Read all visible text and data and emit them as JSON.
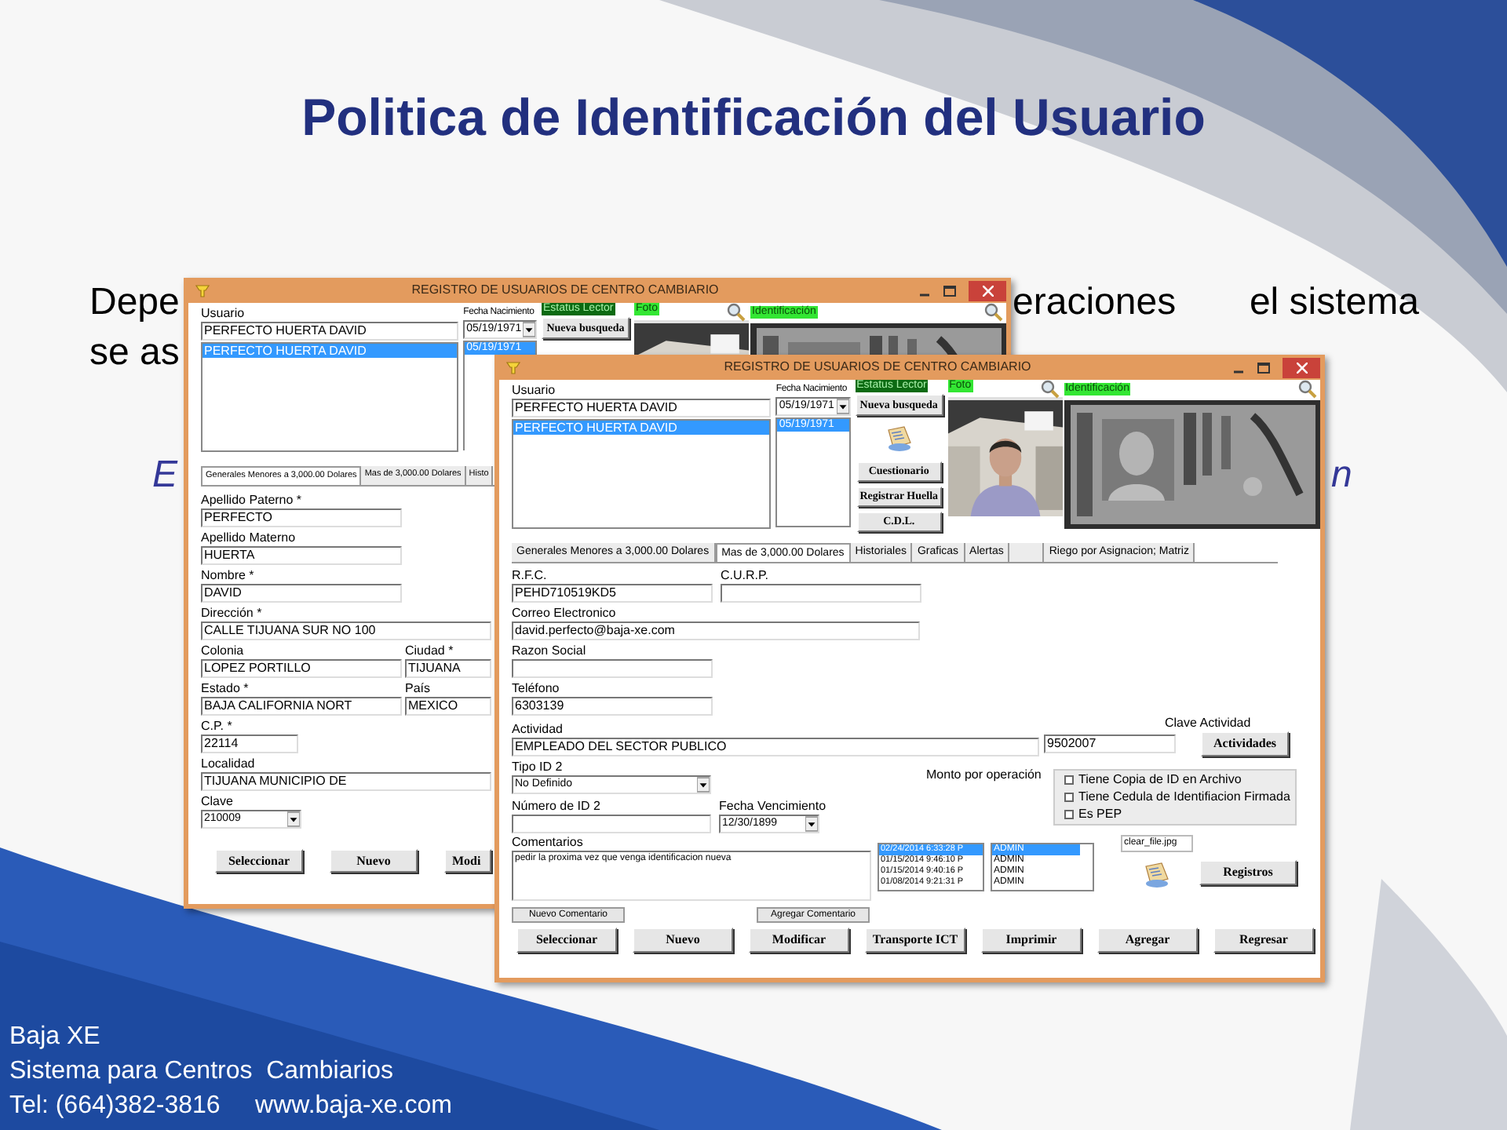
{
  "slide": {
    "title": "Politica de Identificación del Usuario",
    "line_1_start": "Depe",
    "line_1_mid": "eraciones",
    "line_1_end": "el sistema",
    "line_2_start": "se as",
    "line_3_start": "E",
    "line_3_end": "n",
    "footer": [
      "Baja XE",
      "Sistema para Centros  Cambiarios",
      "Tel: (664)382-3816     www.baja-xe.com"
    ]
  },
  "back_window": {
    "title": "REGISTRO DE USUARIOS DE CENTRO CAMBIARIO",
    "user_label": "Usuario",
    "user_value": "PERFECTO HUERTA DAVID",
    "user_list": [
      {
        "text": "PERFECTO HUERTA DAVID",
        "selected": true
      }
    ],
    "date_label": "Fecha Nacimiento",
    "date_value": "05/19/1971",
    "date_list": [
      {
        "text": "05/19/1971",
        "selected": true
      }
    ],
    "status_label": "Estatus Lector",
    "search_button": "Nueva busqueda",
    "photo_label": "Foto",
    "id_label": "Identificación",
    "tabs": [
      {
        "label": "Generales Menores a 3,000.00 Dolares",
        "selected": true
      },
      {
        "label": "Mas de 3,000.00 Dolares",
        "selected": false
      },
      {
        "label": "Histo",
        "selected": false
      }
    ],
    "field_rows": [
      [
        {
          "label": "Apellido Paterno *",
          "value": "PERFECTO",
          "kind": "medium"
        }
      ],
      [
        {
          "label": "Apellido Materno",
          "value": "HUERTA",
          "kind": "medium"
        }
      ],
      [
        {
          "label": "Nombre *",
          "value": "DAVID",
          "kind": "medium"
        }
      ],
      [
        {
          "label": "Dirección *",
          "value": "CALLE TIJUANA SUR NO 100",
          "kind": "wide"
        }
      ],
      [
        {
          "label": "Colonia",
          "value": "LOPEZ PORTILLO",
          "kind": "medium"
        },
        {
          "label": "Ciudad *",
          "value": "TIJUANA",
          "kind": "partial"
        }
      ],
      [
        {
          "label": "Estado *",
          "value": "BAJA CALIFORNIA NORT",
          "kind": "medium"
        },
        {
          "label": "País",
          "value": "MEXICO",
          "kind": "partial"
        }
      ],
      [
        {
          "label": "C.P. *",
          "value": "22114",
          "kind": "short"
        }
      ],
      [
        {
          "label": "Localidad",
          "value": "TIJUANA MUNICIPIO DE",
          "kind": "wide"
        }
      ],
      [
        {
          "label": "Clave",
          "value": "210009",
          "kind": "select"
        }
      ]
    ],
    "buttons": [
      "Seleccionar",
      "Nuevo",
      "Modi"
    ]
  },
  "front_window": {
    "title": "REGISTRO DE USUARIOS DE CENTRO CAMBIARIO",
    "user_label": "Usuario",
    "user_value": "PERFECTO HUERTA DAVID",
    "user_list": [
      {
        "text": "PERFECTO HUERTA DAVID",
        "selected": true
      }
    ],
    "date_label": "Fecha Nacimiento",
    "date_value": "05/19/1971",
    "date_list": [
      {
        "text": "05/19/1971",
        "selected": true
      }
    ],
    "status_label": "Estatus Lector",
    "search_button": "Nueva busqueda",
    "side_buttons": [
      "Cuestionario",
      "Registrar Huella",
      "C.D.L."
    ],
    "photo_label": "Foto",
    "id_label": "Identificación",
    "tabs": [
      {
        "label": "Generales Menores a 3,000.00 Dolares",
        "selected": false
      },
      {
        "label": "Mas de 3,000.00 Dolares",
        "selected": true
      },
      {
        "label": "Historiales",
        "selected": false
      },
      {
        "label": "Graficas",
        "selected": false
      },
      {
        "label": "Alertas",
        "selected": false
      },
      {
        "label": "Riego por Asignacion; Matriz",
        "selected": false
      }
    ],
    "rfc": {
      "label": "R.F.C.",
      "value": "PEHD710519KD5"
    },
    "curp": {
      "label": "C.U.R.P."
    },
    "email": {
      "label": "Correo Electronico",
      "value": "david.perfecto@baja-xe.com"
    },
    "razon": {
      "label": "Razon Social"
    },
    "phone": {
      "label": "Teléfono",
      "value": "6303139"
    },
    "activity": {
      "label": "Actividad",
      "value": "EMPLEADO DEL SECTOR PUBLICO"
    },
    "activity_key": {
      "label": "Clave Actividad",
      "value": "9502007"
    },
    "activity_button": "Actividades",
    "id_type": {
      "label": "Tipo ID 2",
      "value": "No Definido"
    },
    "amount_label": "Monto por operación",
    "checkboxes": [
      {
        "label": "Tiene Copia de ID en Archivo",
        "checked": false
      },
      {
        "label": "Tiene Cedula de Identifiacion Firmada",
        "checked": false
      },
      {
        "label": "Es PEP",
        "checked": false
      }
    ],
    "id_number": {
      "label": "Número de ID 2"
    },
    "expiry": {
      "label": "Fecha Vencimiento",
      "value": "12/30/1899"
    },
    "comments": {
      "label": "Comentarios",
      "value": "pedir la proxima vez que venga identificacion nueva"
    },
    "comment_dates": [
      {
        "text": "02/24/2014 6:33:28 P",
        "selected": true
      },
      {
        "text": "01/15/2014 9:46:10 P",
        "selected": false
      },
      {
        "text": "01/15/2014 9:40:16 P",
        "selected": false
      },
      {
        "text": "01/08/2014 9:21:31 P",
        "selected": false
      }
    ],
    "comment_users": [
      {
        "text": "ADMIN",
        "selected": true
      },
      {
        "text": "ADMIN",
        "selected": false
      },
      {
        "text": "ADMIN",
        "selected": false
      },
      {
        "text": "ADMIN",
        "selected": false
      }
    ],
    "file_value": "clear_file.jpg",
    "records_button": "Registros",
    "comment_buttons": [
      "Nuevo Comentario",
      "Agregar Comentario"
    ],
    "buttons": [
      "Seleccionar",
      "Nuevo",
      "Modificar",
      "Transporte ICT",
      "Imprimir",
      "Agregar",
      "Regresar"
    ]
  }
}
